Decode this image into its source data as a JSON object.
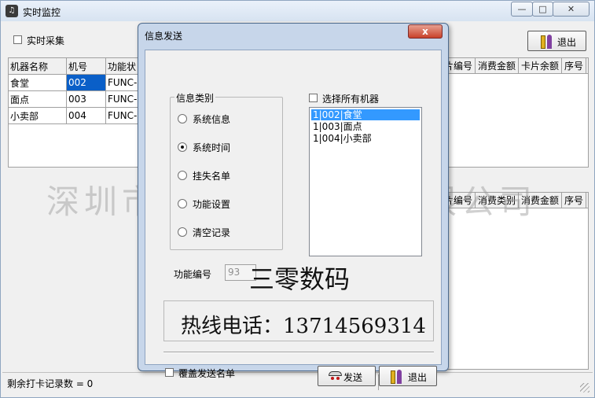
{
  "main_window": {
    "title": "实时监控",
    "realtime_collect_label": "实时采集",
    "exit_label": "退出",
    "machine_table": {
      "headers": [
        "机器名称",
        "机号",
        "功能状"
      ],
      "rows": [
        [
          "食堂",
          "002",
          "FUNC-"
        ],
        [
          "面点",
          "003",
          "FUNC-"
        ],
        [
          "小卖部",
          "004",
          "FUNC-"
        ]
      ]
    },
    "upper_right_headers": [
      "片编号",
      "消费金额",
      "卡片余额",
      "序号"
    ],
    "lower_right_headers": [
      "片编号",
      "消费类别",
      "消费金额",
      "序号"
    ],
    "status_text": "剩余打卡记录数 = 0"
  },
  "watermark": "深圳市三零数码科技有限公司",
  "dialog": {
    "title": "信息发送",
    "close_label": "x",
    "info_type_legend": "信息类别",
    "info_types": [
      {
        "label": "系统信息",
        "checked": false
      },
      {
        "label": "系统时间",
        "checked": true
      },
      {
        "label": "挂失名单",
        "checked": false
      },
      {
        "label": "功能设置",
        "checked": false
      },
      {
        "label": "清空记录",
        "checked": false
      }
    ],
    "select_all_label": "选择所有机器",
    "machines": [
      {
        "label": "1|002|食堂",
        "selected": true
      },
      {
        "label": "1|003|面点",
        "selected": false
      },
      {
        "label": "1|004|小卖部",
        "selected": false
      }
    ],
    "func_no_label": "功能编号",
    "func_no_value": "93",
    "brand_text": "三零数码",
    "hotline_text": "热线电话：13714569314",
    "overwrite_label": "覆盖发送名单",
    "send_label": "发送",
    "exit_label": "退出"
  },
  "colors": {
    "selection": "#3399ff",
    "table_selection": "#0a5fc8",
    "dialog_frame": "#c7d6ea",
    "close_button": "#c8412a"
  }
}
